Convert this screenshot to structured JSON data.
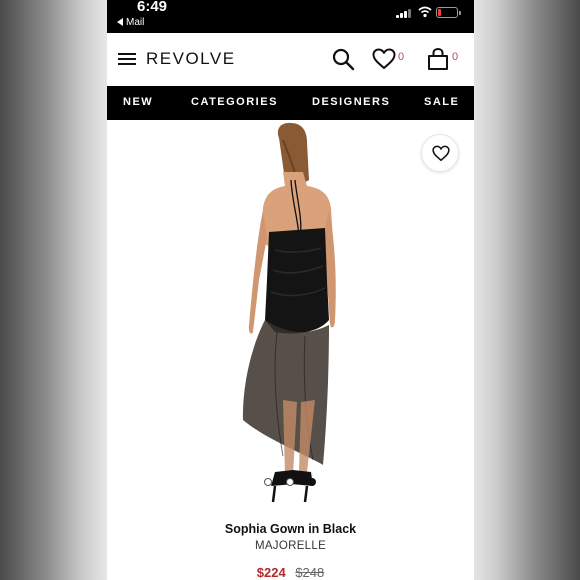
{
  "status_bar": {
    "time": "6:49",
    "back_app": "Mail"
  },
  "header": {
    "logo": "REVOLVE",
    "wishlist_count": "0",
    "bag_count": "0"
  },
  "nav": {
    "items": [
      "NEW",
      "CATEGORIES",
      "DESIGNERS",
      "SALE"
    ]
  },
  "product": {
    "name": "Sophia Gown in Black",
    "brand": "MAJORELLE",
    "price": "$224",
    "original_price": "$248",
    "image_count": 3,
    "active_image": 3
  },
  "colors": {
    "accent_count": "#b5487a",
    "sale_price": "#b22a2a",
    "nav_bg": "#000000"
  },
  "icons": [
    "menu-icon",
    "search-icon",
    "heart-icon",
    "shopping-bag-icon",
    "wishlist-heart-icon"
  ]
}
